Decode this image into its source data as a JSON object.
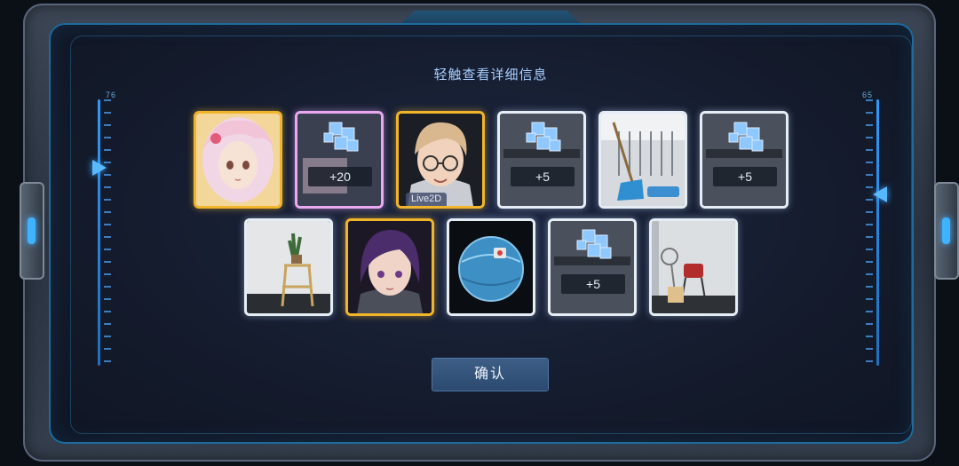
{
  "dialog": {
    "hint": "轻触查看详细信息",
    "confirm_label": "确认",
    "left_ruler_label": "76",
    "right_ruler_label": "65"
  },
  "rewards": {
    "row1": [
      {
        "type": "character",
        "rarity": "gold",
        "name": "pink-haired girl portrait"
      },
      {
        "type": "fragment",
        "rarity": "pink",
        "qty": "+20"
      },
      {
        "type": "character",
        "rarity": "gold",
        "name": "glasses boy portrait",
        "badge": "Live2D"
      },
      {
        "type": "fragment",
        "rarity": "white",
        "qty": "+5"
      },
      {
        "type": "furniture",
        "rarity": "white",
        "name": "broom and dustpan"
      },
      {
        "type": "fragment",
        "rarity": "white",
        "qty": "+5"
      }
    ],
    "row2": [
      {
        "type": "furniture",
        "rarity": "white",
        "name": "wooden plant stand"
      },
      {
        "type": "character",
        "rarity": "gold",
        "name": "purple-haired girl portrait"
      },
      {
        "type": "item",
        "rarity": "white",
        "name": "blue exercise ball"
      },
      {
        "type": "fragment",
        "rarity": "white",
        "qty": "+5"
      },
      {
        "type": "furniture",
        "rarity": "white",
        "name": "chair and box"
      }
    ]
  },
  "colors": {
    "gold_border": "#f1b52c",
    "pink_border": "#e9a9f2",
    "white_border": "#e6edf5",
    "accent_blue": "#3fb3ff"
  }
}
